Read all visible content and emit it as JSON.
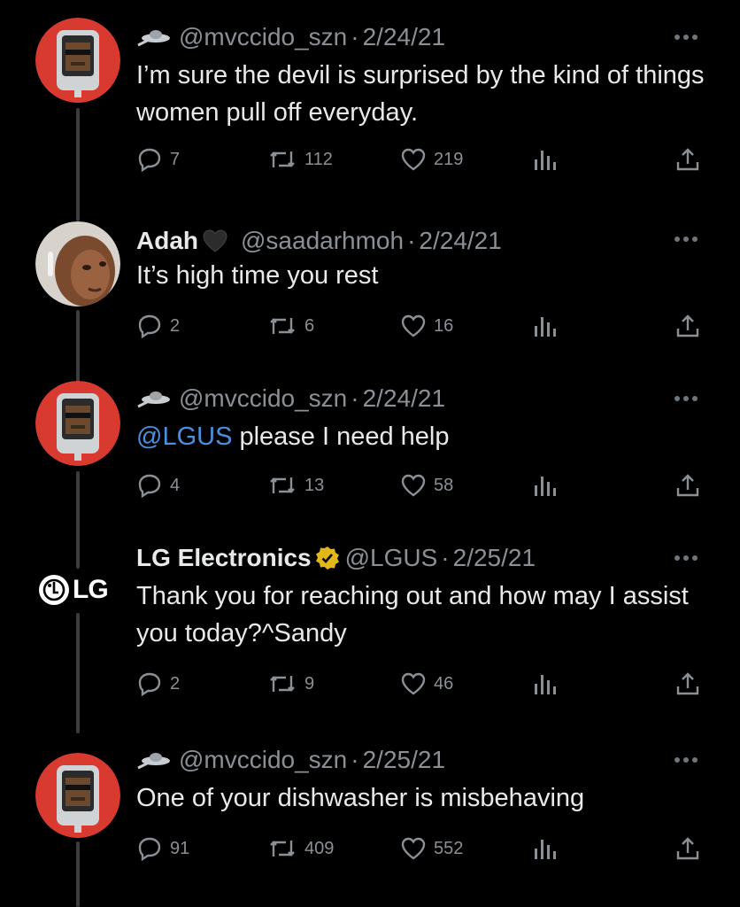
{
  "tweets": [
    {
      "display_name": "",
      "handle": "@mvccido_szn",
      "date": "2/24/21",
      "text": "I’m sure the devil is surprised by the kind of things women pull off everyday.",
      "replies": "7",
      "retweets": "112",
      "likes": "219"
    },
    {
      "display_name": "Adah",
      "handle": "@saadarhmoh",
      "date": "2/24/21",
      "text": "It’s high time you rest",
      "replies": "2",
      "retweets": "6",
      "likes": "16"
    },
    {
      "display_name": "",
      "handle": "@mvccido_szn",
      "date": "2/24/21",
      "mention": "@LGUS",
      "text": " please I need help",
      "replies": "4",
      "retweets": "13",
      "likes": "58"
    },
    {
      "display_name": "LG Electronics",
      "handle": "@LGUS",
      "date": "2/25/21",
      "text": "Thank you for reaching out and how may I assist you today?^Sandy",
      "replies": "2",
      "retweets": "9",
      "likes": "46",
      "avatar_text": "LG"
    },
    {
      "display_name": "",
      "handle": "@mvccido_szn",
      "date": "2/25/21",
      "text": "One of your dishwasher is misbehaving",
      "replies": "91",
      "retweets": "409",
      "likes": "552"
    }
  ],
  "separator": "·",
  "colors": {
    "background": "#000000",
    "text": "#e7e9ea",
    "muted": "#8b9096",
    "link": "#4a90e2",
    "avatar_red": "#d93a2f",
    "verified_gold": "#e2b719"
  },
  "icons": [
    "ufo-icon",
    "reply-icon",
    "retweet-icon",
    "like-icon",
    "views-icon",
    "share-icon",
    "more-icon",
    "verified-badge-icon",
    "black-heart-icon"
  ]
}
